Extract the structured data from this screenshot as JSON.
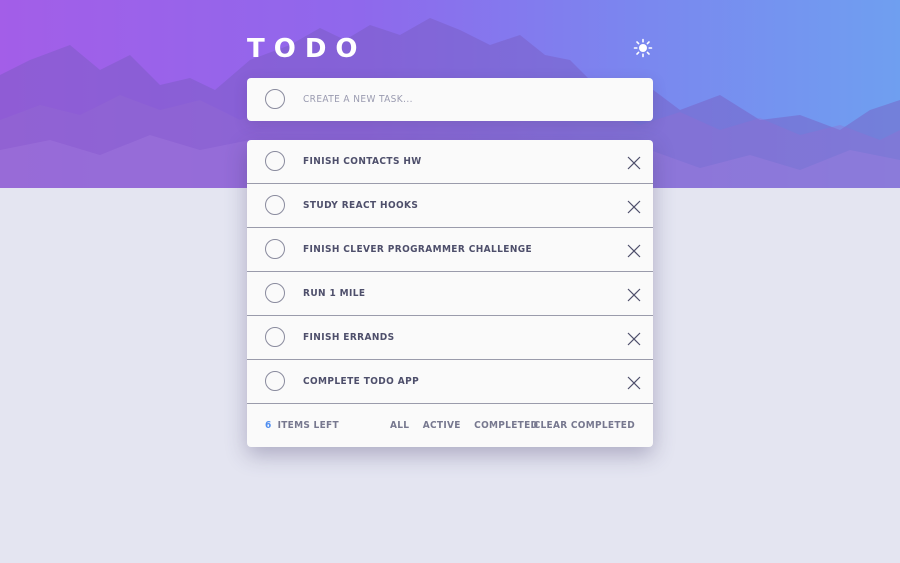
{
  "app": {
    "title": "TODO",
    "theme_toggle_icon": "sun-icon",
    "colors": {
      "accent": "#4f8ef0",
      "background": "#e4e5f1",
      "card": "#fafafa",
      "gradient_start": "#a35ee8",
      "gradient_end": "#6f9ff0"
    }
  },
  "new_task": {
    "placeholder": "CREATE A NEW TASK...",
    "value": ""
  },
  "todos": [
    {
      "text": "FINISH CONTACTS HW"
    },
    {
      "text": "STUDY REACT HOOKS"
    },
    {
      "text": "FINISH CLEVER PROGRAMMER CHALLENGE"
    },
    {
      "text": "RUN 1 MILE"
    },
    {
      "text": "FINISH ERRANDS"
    },
    {
      "text": "COMPLETE TODO APP"
    }
  ],
  "footer": {
    "count": "6",
    "items_left_label": "ITEMS LEFT",
    "filters": {
      "all": "ALL",
      "active": "ACTIVE",
      "completed": "COMPLETED"
    },
    "clear_completed": "CLEAR COMPLETED"
  }
}
